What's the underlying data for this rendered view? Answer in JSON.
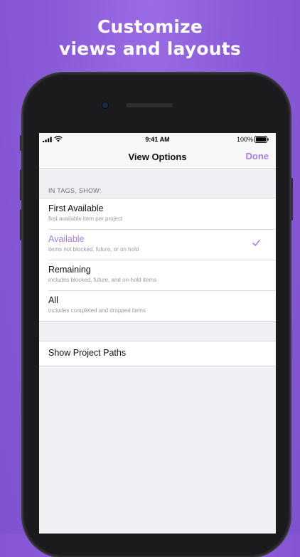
{
  "headline": {
    "line1": "Customize",
    "line2": "views and layouts"
  },
  "status_bar": {
    "time": "9:41 AM",
    "battery": "100%"
  },
  "nav": {
    "title": "View Options",
    "done_label": "Done"
  },
  "tags_section": {
    "header": "IN TAGS, SHOW:",
    "options": [
      {
        "title": "First Available",
        "subtitle": "first available item per project",
        "selected": false
      },
      {
        "title": "Available",
        "subtitle": "items not blocked, future, or on hold",
        "selected": true
      },
      {
        "title": "Remaining",
        "subtitle": "includes blocked, future, and on-hold items",
        "selected": false
      },
      {
        "title": "All",
        "subtitle": "includes completed and dropped items",
        "selected": false
      }
    ]
  },
  "project_paths": {
    "label": "Show Project Paths"
  },
  "colors": {
    "accent": "#a67fe0",
    "background": "#8a5bd8"
  },
  "icons": {
    "selected_marker": "checkmark-icon"
  }
}
